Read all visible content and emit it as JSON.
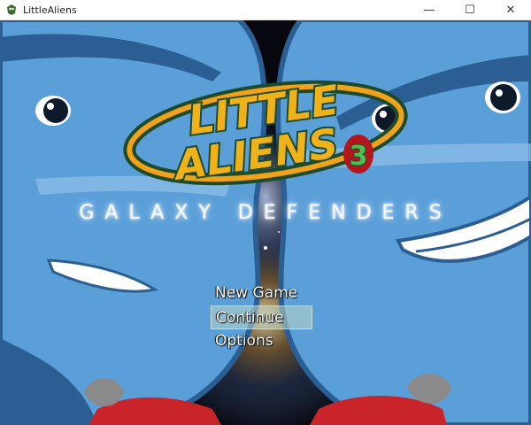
{
  "window": {
    "title": "LittleAliens",
    "controls": {
      "minimize": "—",
      "maximize": "☐",
      "close": "✕"
    }
  },
  "logo": {
    "line1": "LITTLE",
    "line2": "ALIENS",
    "number": "3",
    "colors": {
      "text": "#f0b21a",
      "outline": "#1c4a2b",
      "ring": "#f0a21a",
      "badge": "#b3161c"
    }
  },
  "subtitle": "GALAXY DEFENDERS",
  "menu": {
    "items": [
      {
        "label": "New Game",
        "selected": false
      },
      {
        "label": "Continue",
        "selected": true
      },
      {
        "label": "Options",
        "selected": false
      }
    ]
  },
  "colors": {
    "alien_blue": "#5b9fd8",
    "alien_dark": "#2b5f93",
    "space": "#07080f"
  }
}
